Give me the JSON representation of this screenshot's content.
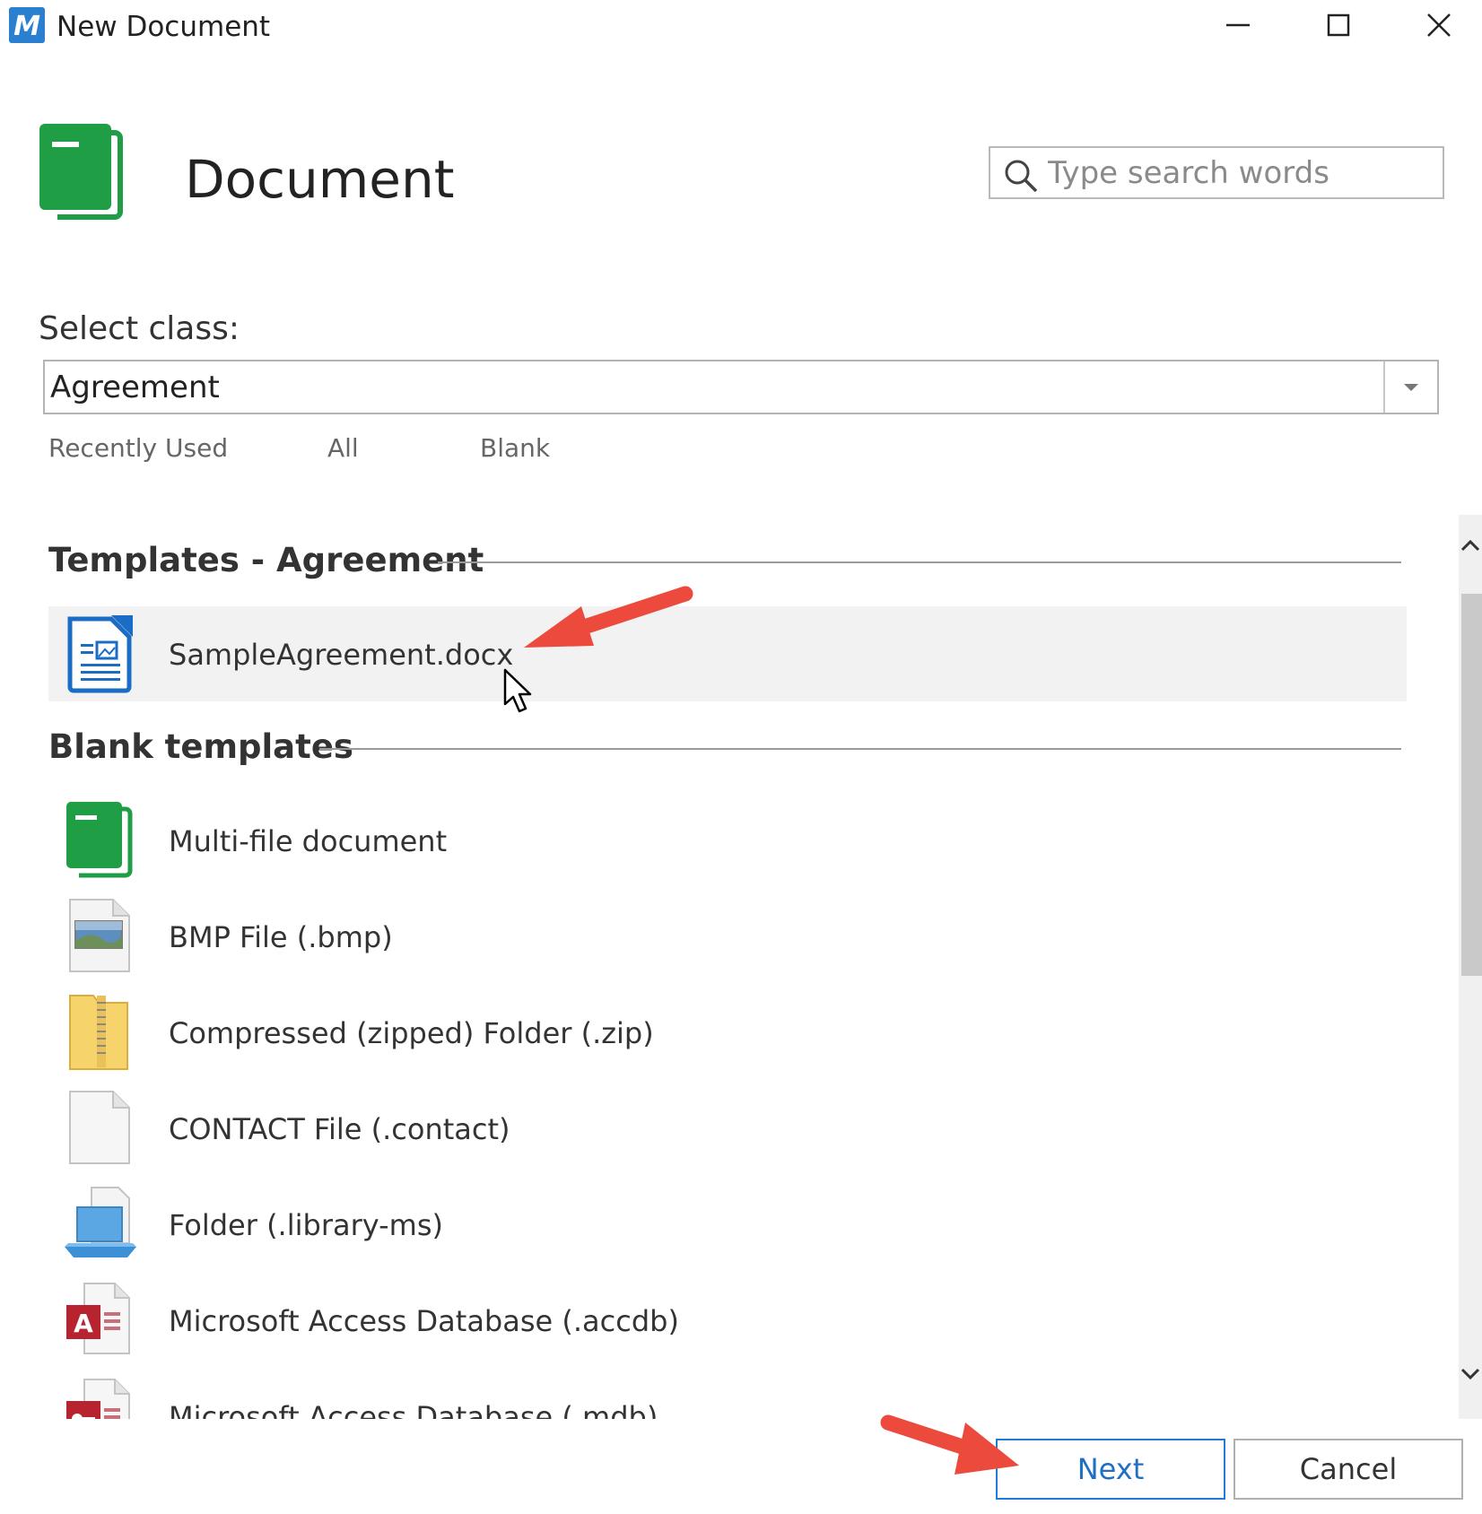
{
  "window": {
    "title": "New Document",
    "app_icon_letter": "M",
    "controls": [
      "minimize-icon",
      "maximize-icon",
      "close-icon"
    ]
  },
  "header": {
    "title": "Document",
    "icon": "document-class-icon"
  },
  "search": {
    "placeholder": "Type search words",
    "icon": "search-icon"
  },
  "class_select": {
    "label": "Select class:",
    "value": "Agreement"
  },
  "filter_tabs": [
    "Recently Used",
    "All",
    "Blank"
  ],
  "sections": [
    {
      "heading": "Templates - Agreement",
      "items": [
        {
          "label": "SampleAgreement.docx",
          "icon": "docx-file-icon"
        }
      ]
    },
    {
      "heading": "Blank templates",
      "items": [
        {
          "label": "Multi-file document",
          "icon": "multi-file-document-icon"
        },
        {
          "label": "BMP File (.bmp)",
          "icon": "bmp-file-icon"
        },
        {
          "label": "Compressed (zipped) Folder (.zip)",
          "icon": "zip-folder-icon"
        },
        {
          "label": "CONTACT File (.contact)",
          "icon": "blank-file-icon"
        },
        {
          "label": "Folder (.library-ms)",
          "icon": "library-folder-icon"
        },
        {
          "label": "Microsoft Access Database (.accdb)",
          "icon": "access-database-icon"
        },
        {
          "label": "Microsoft Access Database (.mdb)",
          "icon": "access-mdb-icon"
        }
      ]
    }
  ],
  "buttons": {
    "next": "Next",
    "cancel": "Cancel"
  },
  "colors": {
    "brand_green": "#1f9e45",
    "accent_blue": "#1f7bd4",
    "annotation_red": "#ec4a3c"
  }
}
